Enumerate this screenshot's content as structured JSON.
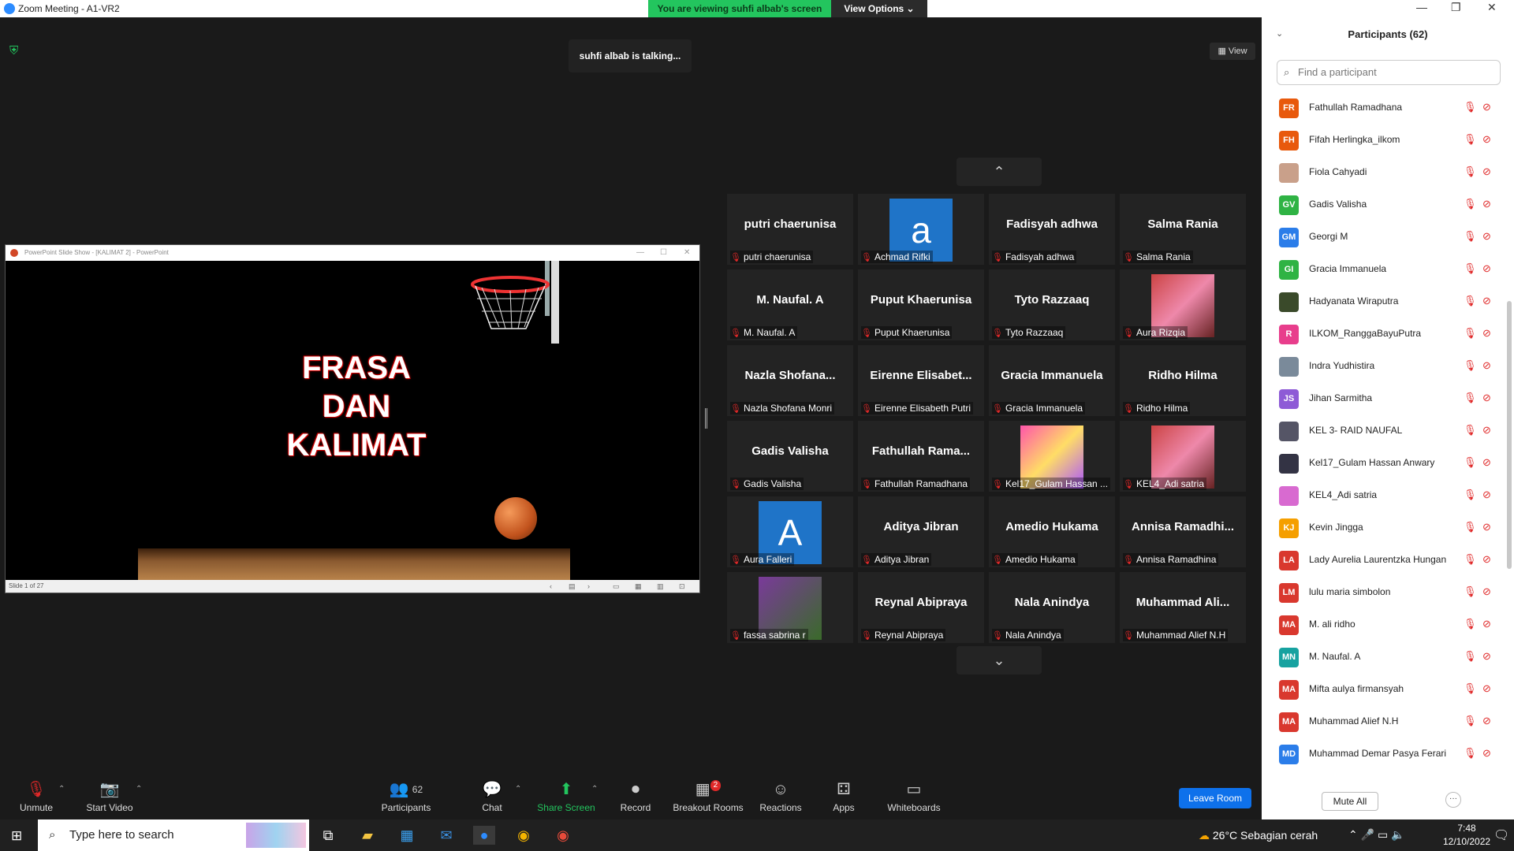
{
  "window": {
    "title": "Zoom Meeting - A1-VR2",
    "minimize": "—",
    "maximize": "❐",
    "close": "✕"
  },
  "share_banner": "You are viewing suhfi albab's screen",
  "view_options": "View Options ⌄",
  "talking_indicator": "suhfi albab is talking...",
  "view_button": "View",
  "shared_window": {
    "title": "PowerPoint Slide Show - [KALIMAT 2] - PowerPoint",
    "slide_title": "FRASA DAN KALIMAT",
    "status": "Slide 1 of 27"
  },
  "gallery": {
    "tiles": [
      {
        "name": "putri chaerunisa",
        "label": "putri chaerunisa",
        "avatar": "none"
      },
      {
        "name": "",
        "label": "Achmad Rifki",
        "avatar": "a"
      },
      {
        "name": "Fadisyah adhwa",
        "label": "Fadisyah adhwa",
        "avatar": "none"
      },
      {
        "name": "Salma Rania",
        "label": "Salma Rania",
        "avatar": "none"
      },
      {
        "name": "M. Naufal. A",
        "label": "M. Naufal. A",
        "avatar": "none"
      },
      {
        "name": "Puput Khaerunisa",
        "label": "Puput Khaerunisa",
        "avatar": "none"
      },
      {
        "name": "Tyto Razzaaq",
        "label": "Tyto Razzaaq",
        "avatar": "none"
      },
      {
        "name": "",
        "label": "Aura Rizqia",
        "avatar": "image"
      },
      {
        "name": "Nazla  Shofana...",
        "label": "Nazla Shofana Monri",
        "avatar": "none"
      },
      {
        "name": "Eirenne  Elisabet...",
        "label": "Eirenne Elisabeth Putri",
        "avatar": "none"
      },
      {
        "name": "Gracia Immanuela",
        "label": "Gracia Immanuela",
        "avatar": "none"
      },
      {
        "name": "Ridho Hilma",
        "label": "Ridho Hilma",
        "avatar": "none"
      },
      {
        "name": "Gadis Valisha",
        "label": "Gadis Valisha",
        "avatar": "none"
      },
      {
        "name": "Fathullah  Rama...",
        "label": "Fathullah Ramadhana",
        "avatar": "none"
      },
      {
        "name": "",
        "label": "Kel17_Gulam Hassan ...",
        "avatar": "image"
      },
      {
        "name": "",
        "label": "KEL4_Adi satria",
        "avatar": "image"
      },
      {
        "name": "",
        "label": "Aura Falleri",
        "avatar": "A"
      },
      {
        "name": "Aditya Jibran",
        "label": "Aditya Jibran",
        "avatar": "none"
      },
      {
        "name": "Amedio Hukama",
        "label": "Amedio Hukama",
        "avatar": "none"
      },
      {
        "name": "Annisa  Ramadhi...",
        "label": "Annisa Ramadhina",
        "avatar": "none"
      },
      {
        "name": "",
        "label": "fassa sabrina r",
        "avatar": "image"
      },
      {
        "name": "Reynal Abipraya",
        "label": "Reynal Abipraya",
        "avatar": "none"
      },
      {
        "name": "Nala Anindya",
        "label": "Nala Anindya",
        "avatar": "none"
      },
      {
        "name": "Muhammad  Ali...",
        "label": "Muhammad Alief N.H",
        "avatar": "none"
      }
    ]
  },
  "toolbar": {
    "unmute": "Unmute",
    "start_video": "Start Video",
    "participants": "Participants",
    "participants_count": "62",
    "chat": "Chat",
    "share_screen": "Share Screen",
    "record": "Record",
    "breakout_rooms": "Breakout Rooms",
    "breakout_badge": "2",
    "reactions": "Reactions",
    "apps": "Apps",
    "whiteboards": "Whiteboards",
    "leave": "Leave Room"
  },
  "panel": {
    "title": "Participants (62)",
    "search_placeholder": "Find a participant",
    "mute_all": "Mute All",
    "more": "···",
    "participants": [
      {
        "initials": "FR",
        "name": "Fathullah Ramadhana",
        "color": "#e8590c"
      },
      {
        "initials": "FH",
        "name": "Fifah Herlingka_ilkom",
        "color": "#e8590c"
      },
      {
        "initials": "",
        "name": "Fiola Cahyadi",
        "color": "#c9a08a"
      },
      {
        "initials": "GV",
        "name": "Gadis Valisha",
        "color": "#2fb344"
      },
      {
        "initials": "GM",
        "name": "Georgi M",
        "color": "#2b7de9"
      },
      {
        "initials": "GI",
        "name": "Gracia Immanuela",
        "color": "#2fb344"
      },
      {
        "initials": "",
        "name": "Hadyanata Wiraputra",
        "color": "#3a4a2a"
      },
      {
        "initials": "R",
        "name": "ILKOM_RanggaBayuPutra",
        "color": "#e83e8c"
      },
      {
        "initials": "",
        "name": "Indra Yudhistira",
        "color": "#7a8a9a"
      },
      {
        "initials": "JS",
        "name": "Jihan Sarmitha",
        "color": "#8e5bd6"
      },
      {
        "initials": "",
        "name": "KEL 3- RAID NAUFAL",
        "color": "#556"
      },
      {
        "initials": "",
        "name": "Kel17_Gulam Hassan Anwary",
        "color": "#334"
      },
      {
        "initials": "",
        "name": "KEL4_Adi satria",
        "color": "#d86ad0"
      },
      {
        "initials": "KJ",
        "name": "Kevin Jingga",
        "color": "#f59f00"
      },
      {
        "initials": "LA",
        "name": "Lady Aurelia Laurentzka Hungan",
        "color": "#d9382e"
      },
      {
        "initials": "LM",
        "name": "lulu maria simbolon",
        "color": "#d9382e"
      },
      {
        "initials": "MA",
        "name": "M. ali ridho",
        "color": "#d9382e"
      },
      {
        "initials": "MN",
        "name": "M. Naufal. A",
        "color": "#17a2a0"
      },
      {
        "initials": "MA",
        "name": "Mifta aulya firmansyah",
        "color": "#d9382e"
      },
      {
        "initials": "MA",
        "name": "Muhammad Alief N.H",
        "color": "#d9382e"
      },
      {
        "initials": "MD",
        "name": "Muhammad Demar Pasya Ferari",
        "color": "#2b7de9"
      }
    ]
  },
  "taskbar": {
    "search_placeholder": "Type here to search",
    "weather": "26°C  Sebagian cerah",
    "time": "7:48",
    "date": "12/10/2022"
  }
}
